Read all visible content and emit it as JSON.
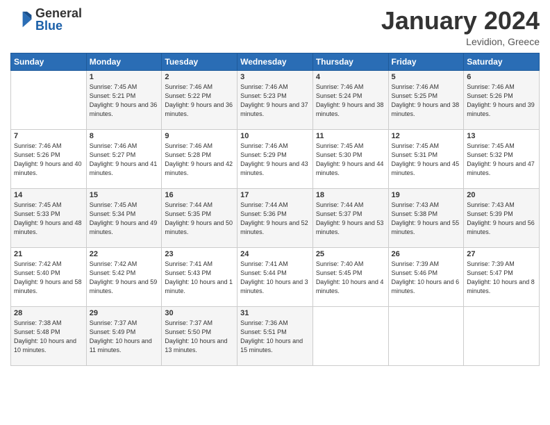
{
  "header": {
    "logo_general": "General",
    "logo_blue": "Blue",
    "month_title": "January 2024",
    "location": "Levidion, Greece"
  },
  "weekdays": [
    "Sunday",
    "Monday",
    "Tuesday",
    "Wednesday",
    "Thursday",
    "Friday",
    "Saturday"
  ],
  "weeks": [
    [
      {
        "day": "",
        "info": ""
      },
      {
        "day": "1",
        "info": "Sunrise: 7:45 AM\nSunset: 5:21 PM\nDaylight: 9 hours\nand 36 minutes."
      },
      {
        "day": "2",
        "info": "Sunrise: 7:46 AM\nSunset: 5:22 PM\nDaylight: 9 hours\nand 36 minutes."
      },
      {
        "day": "3",
        "info": "Sunrise: 7:46 AM\nSunset: 5:23 PM\nDaylight: 9 hours\nand 37 minutes."
      },
      {
        "day": "4",
        "info": "Sunrise: 7:46 AM\nSunset: 5:24 PM\nDaylight: 9 hours\nand 38 minutes."
      },
      {
        "day": "5",
        "info": "Sunrise: 7:46 AM\nSunset: 5:25 PM\nDaylight: 9 hours\nand 38 minutes."
      },
      {
        "day": "6",
        "info": "Sunrise: 7:46 AM\nSunset: 5:26 PM\nDaylight: 9 hours\nand 39 minutes."
      }
    ],
    [
      {
        "day": "7",
        "info": "Sunrise: 7:46 AM\nSunset: 5:26 PM\nDaylight: 9 hours\nand 40 minutes."
      },
      {
        "day": "8",
        "info": "Sunrise: 7:46 AM\nSunset: 5:27 PM\nDaylight: 9 hours\nand 41 minutes."
      },
      {
        "day": "9",
        "info": "Sunrise: 7:46 AM\nSunset: 5:28 PM\nDaylight: 9 hours\nand 42 minutes."
      },
      {
        "day": "10",
        "info": "Sunrise: 7:46 AM\nSunset: 5:29 PM\nDaylight: 9 hours\nand 43 minutes."
      },
      {
        "day": "11",
        "info": "Sunrise: 7:45 AM\nSunset: 5:30 PM\nDaylight: 9 hours\nand 44 minutes."
      },
      {
        "day": "12",
        "info": "Sunrise: 7:45 AM\nSunset: 5:31 PM\nDaylight: 9 hours\nand 45 minutes."
      },
      {
        "day": "13",
        "info": "Sunrise: 7:45 AM\nSunset: 5:32 PM\nDaylight: 9 hours\nand 47 minutes."
      }
    ],
    [
      {
        "day": "14",
        "info": "Sunrise: 7:45 AM\nSunset: 5:33 PM\nDaylight: 9 hours\nand 48 minutes."
      },
      {
        "day": "15",
        "info": "Sunrise: 7:45 AM\nSunset: 5:34 PM\nDaylight: 9 hours\nand 49 minutes."
      },
      {
        "day": "16",
        "info": "Sunrise: 7:44 AM\nSunset: 5:35 PM\nDaylight: 9 hours\nand 50 minutes."
      },
      {
        "day": "17",
        "info": "Sunrise: 7:44 AM\nSunset: 5:36 PM\nDaylight: 9 hours\nand 52 minutes."
      },
      {
        "day": "18",
        "info": "Sunrise: 7:44 AM\nSunset: 5:37 PM\nDaylight: 9 hours\nand 53 minutes."
      },
      {
        "day": "19",
        "info": "Sunrise: 7:43 AM\nSunset: 5:38 PM\nDaylight: 9 hours\nand 55 minutes."
      },
      {
        "day": "20",
        "info": "Sunrise: 7:43 AM\nSunset: 5:39 PM\nDaylight: 9 hours\nand 56 minutes."
      }
    ],
    [
      {
        "day": "21",
        "info": "Sunrise: 7:42 AM\nSunset: 5:40 PM\nDaylight: 9 hours\nand 58 minutes."
      },
      {
        "day": "22",
        "info": "Sunrise: 7:42 AM\nSunset: 5:42 PM\nDaylight: 9 hours\nand 59 minutes."
      },
      {
        "day": "23",
        "info": "Sunrise: 7:41 AM\nSunset: 5:43 PM\nDaylight: 10 hours\nand 1 minute."
      },
      {
        "day": "24",
        "info": "Sunrise: 7:41 AM\nSunset: 5:44 PM\nDaylight: 10 hours\nand 3 minutes."
      },
      {
        "day": "25",
        "info": "Sunrise: 7:40 AM\nSunset: 5:45 PM\nDaylight: 10 hours\nand 4 minutes."
      },
      {
        "day": "26",
        "info": "Sunrise: 7:39 AM\nSunset: 5:46 PM\nDaylight: 10 hours\nand 6 minutes."
      },
      {
        "day": "27",
        "info": "Sunrise: 7:39 AM\nSunset: 5:47 PM\nDaylight: 10 hours\nand 8 minutes."
      }
    ],
    [
      {
        "day": "28",
        "info": "Sunrise: 7:38 AM\nSunset: 5:48 PM\nDaylight: 10 hours\nand 10 minutes."
      },
      {
        "day": "29",
        "info": "Sunrise: 7:37 AM\nSunset: 5:49 PM\nDaylight: 10 hours\nand 11 minutes."
      },
      {
        "day": "30",
        "info": "Sunrise: 7:37 AM\nSunset: 5:50 PM\nDaylight: 10 hours\nand 13 minutes."
      },
      {
        "day": "31",
        "info": "Sunrise: 7:36 AM\nSunset: 5:51 PM\nDaylight: 10 hours\nand 15 minutes."
      },
      {
        "day": "",
        "info": ""
      },
      {
        "day": "",
        "info": ""
      },
      {
        "day": "",
        "info": ""
      }
    ]
  ]
}
